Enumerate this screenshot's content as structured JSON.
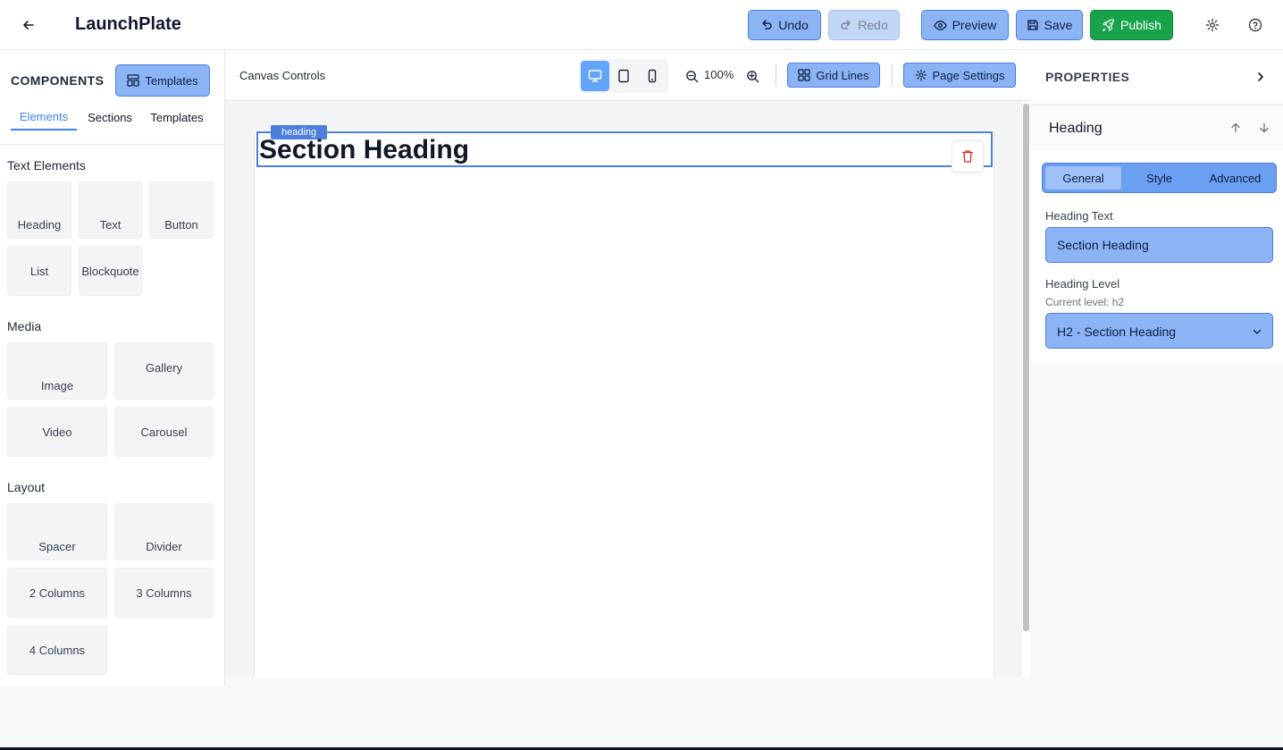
{
  "app": {
    "title": "LaunchPlate"
  },
  "toolbar": {
    "undo": "Undo",
    "redo": "Redo",
    "preview": "Preview",
    "save": "Save",
    "publish": "Publish"
  },
  "sidebar": {
    "heading": "COMPONENTS",
    "templates_button": "Templates",
    "tabs": [
      "Elements",
      "Sections",
      "Templates"
    ],
    "active_tab": "Elements",
    "groups": [
      {
        "title": "Text Elements",
        "items": [
          "Heading",
          "Text",
          "Button",
          "List",
          "Blockquote"
        ]
      },
      {
        "title": "Media",
        "items": [
          "Image",
          "Gallery",
          "Video",
          "Carousel"
        ]
      },
      {
        "title": "Layout",
        "items": [
          "Spacer",
          "Divider",
          "2 Columns",
          "3 Columns",
          "4 Columns"
        ]
      }
    ]
  },
  "canvas": {
    "controls_label": "Canvas Controls",
    "devices": [
      "desktop",
      "tablet",
      "mobile"
    ],
    "active_device": "desktop",
    "zoom": "100%",
    "grid_lines": "Grid Lines",
    "page_settings": "Page Settings",
    "selected_element": {
      "tag": "heading",
      "text": "Section Heading"
    }
  },
  "properties": {
    "title": "PROPERTIES",
    "element_name": "Heading",
    "tabs": [
      "General",
      "Style",
      "Advanced"
    ],
    "active_tab": "General",
    "heading_text_label": "Heading Text",
    "heading_text_value": "Section Heading",
    "heading_level_label": "Heading Level",
    "heading_level_current": "Current level: h2",
    "heading_level_value": "H2 - Section Heading"
  },
  "colors": {
    "accent": "#4a7fdc",
    "button_fill": "#8cb4f5",
    "publish": "#16a34a",
    "danger": "#dc2626"
  }
}
